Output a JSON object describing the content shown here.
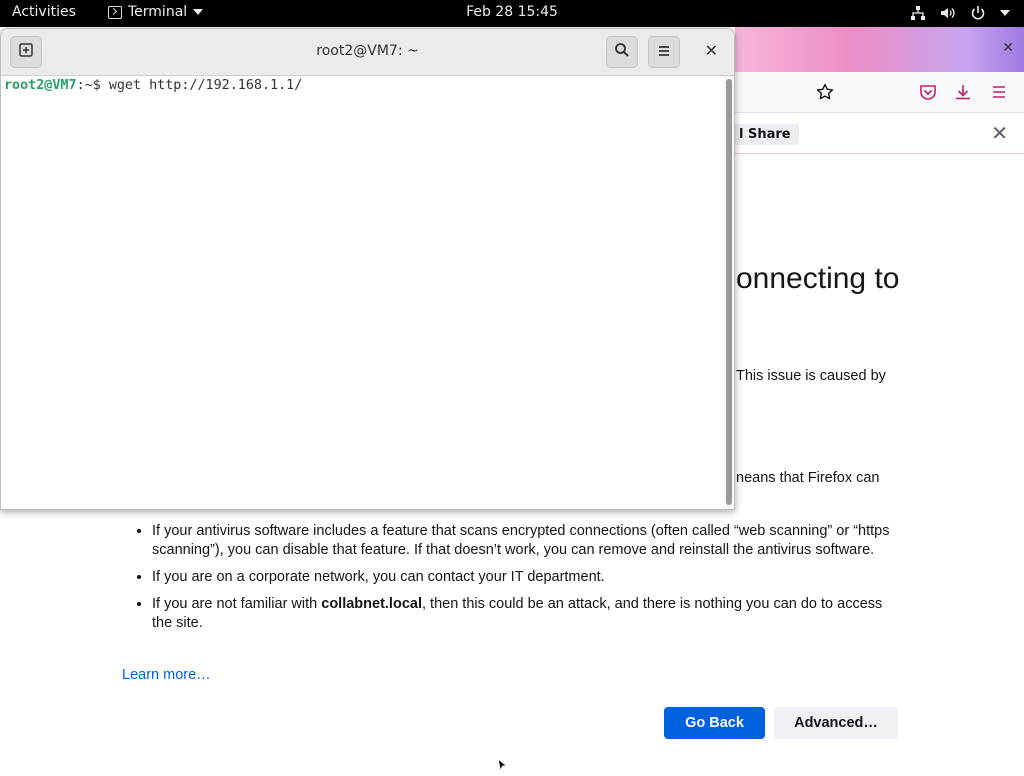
{
  "topbar": {
    "activities": "Activities",
    "app_name": "Terminal",
    "clock": "Feb 28  15:45",
    "icons": [
      "network-icon",
      "volume-icon",
      "power-icon",
      "chevron-down-icon"
    ]
  },
  "terminal": {
    "title": "root2@VM7: ~",
    "prompt_user": "root2@VM7",
    "prompt_path": ":~",
    "prompt_symbol": "$ ",
    "command": "wget http://192.168.1.1/",
    "icons": [
      "new-tab-icon",
      "search-icon",
      "menu-icon",
      "close-icon"
    ]
  },
  "firefox": {
    "notification_button": "l Share",
    "error_title_fragment": "onnecting to",
    "fragment_1": "This issue is caused by",
    "fragment_2": "neans that Firefox can",
    "bullets": [
      "If your antivirus software includes a feature that scans encrypted connections (often called “web scanning” or “https scanning”), you can disable that feature. If that doesn’t work, you can remove and reinstall the antivirus software.",
      "If you are on a corporate network, you can contact your IT department."
    ],
    "bullet3_prefix": "If you are not familiar with ",
    "bullet3_host": "collabnet.local",
    "bullet3_suffix": ", then this could be an attack, and there is nothing you can do to access the site.",
    "learn_more": "Learn more…",
    "go_back": "Go Back",
    "advanced": "Advanced…",
    "colors": {
      "primary_button": "#0061e0",
      "link": "#0060df"
    }
  }
}
